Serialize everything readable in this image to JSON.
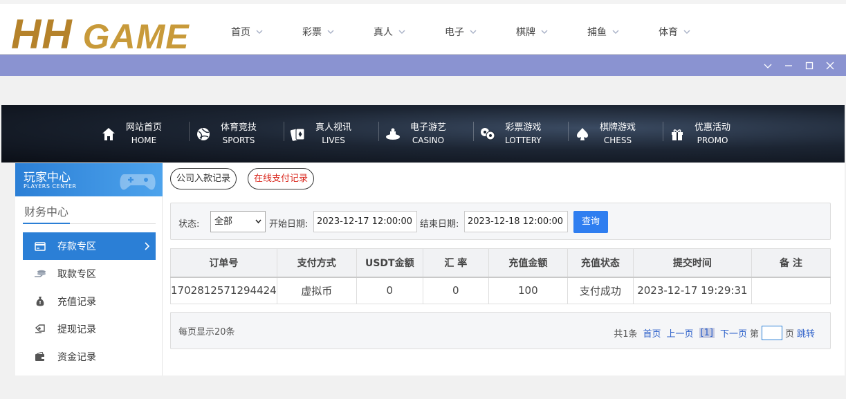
{
  "site": {
    "logo_text_hh": "HH",
    "logo_text_game": " GAME",
    "nav": [
      {
        "label": "首页"
      },
      {
        "label": "彩票"
      },
      {
        "label": "真人"
      },
      {
        "label": "电子"
      },
      {
        "label": "棋牌"
      },
      {
        "label": "捕鱼"
      },
      {
        "label": "体育"
      }
    ]
  },
  "banner": {
    "items": [
      {
        "cn": "网站首页",
        "en": "HOME",
        "icon": "home-icon"
      },
      {
        "cn": "体育竞技",
        "en": "SPORTS",
        "icon": "ball-icon"
      },
      {
        "cn": "真人视讯",
        "en": "LIVES",
        "icon": "cards-icon"
      },
      {
        "cn": "电子游艺",
        "en": "CASINO",
        "icon": "slot-icon"
      },
      {
        "cn": "彩票游戏",
        "en": "LOTTERY",
        "icon": "lottery-balls-icon"
      },
      {
        "cn": "棋牌游戏",
        "en": "CHESS",
        "icon": "spade-icon"
      },
      {
        "cn": "优惠活动",
        "en": "PROMO",
        "icon": "gift-icon"
      }
    ]
  },
  "sidebar": {
    "title_cn": "玩家中心",
    "title_en": "PLAYERS CENTER",
    "section": "财务中心",
    "items": [
      {
        "label": "存款专区",
        "icon": "card-icon",
        "active": true
      },
      {
        "label": "取款专区",
        "icon": "coins-icon",
        "active": false
      },
      {
        "label": "充值记录",
        "icon": "money-bag-icon",
        "active": false
      },
      {
        "label": "提现记录",
        "icon": "withdraw-icon",
        "active": false
      },
      {
        "label": "资金记录",
        "icon": "wallet-icon",
        "active": false
      }
    ]
  },
  "tabs": {
    "company": "公司入款记录",
    "online": "在线支付记录"
  },
  "filter": {
    "status_label": "状态:",
    "status_value": "全部",
    "start_label": "开始日期:",
    "start_value": "2023-12-17 12:00:00",
    "end_label": "结束日期:",
    "end_value": "2023-12-18 12:00:00",
    "query_button": "查询"
  },
  "table": {
    "headers": [
      "订单号",
      "支付方式",
      "USDT金额",
      "汇 率",
      "充值金额",
      "充值状态",
      "提交时间",
      "备 注"
    ],
    "rows": [
      [
        "1702812571294424",
        "虚拟币",
        "0",
        "0",
        "100",
        "支付成功",
        "2023-12-17 19:29:31",
        ""
      ]
    ]
  },
  "pager": {
    "per_page": "每页显示20条",
    "total": "共1条",
    "first": "首页",
    "prev": "上一页",
    "current": "[1]",
    "next": "下一页",
    "page_prefix": "第",
    "page_suffix": "页",
    "jump": "跳转"
  },
  "colors": {
    "titlebar": "#8a93d1",
    "accent": "#2b7fd6",
    "query_button": "#2f7ef0",
    "tab_red": "#d9261c",
    "logo_gold": "#c89a3a"
  }
}
